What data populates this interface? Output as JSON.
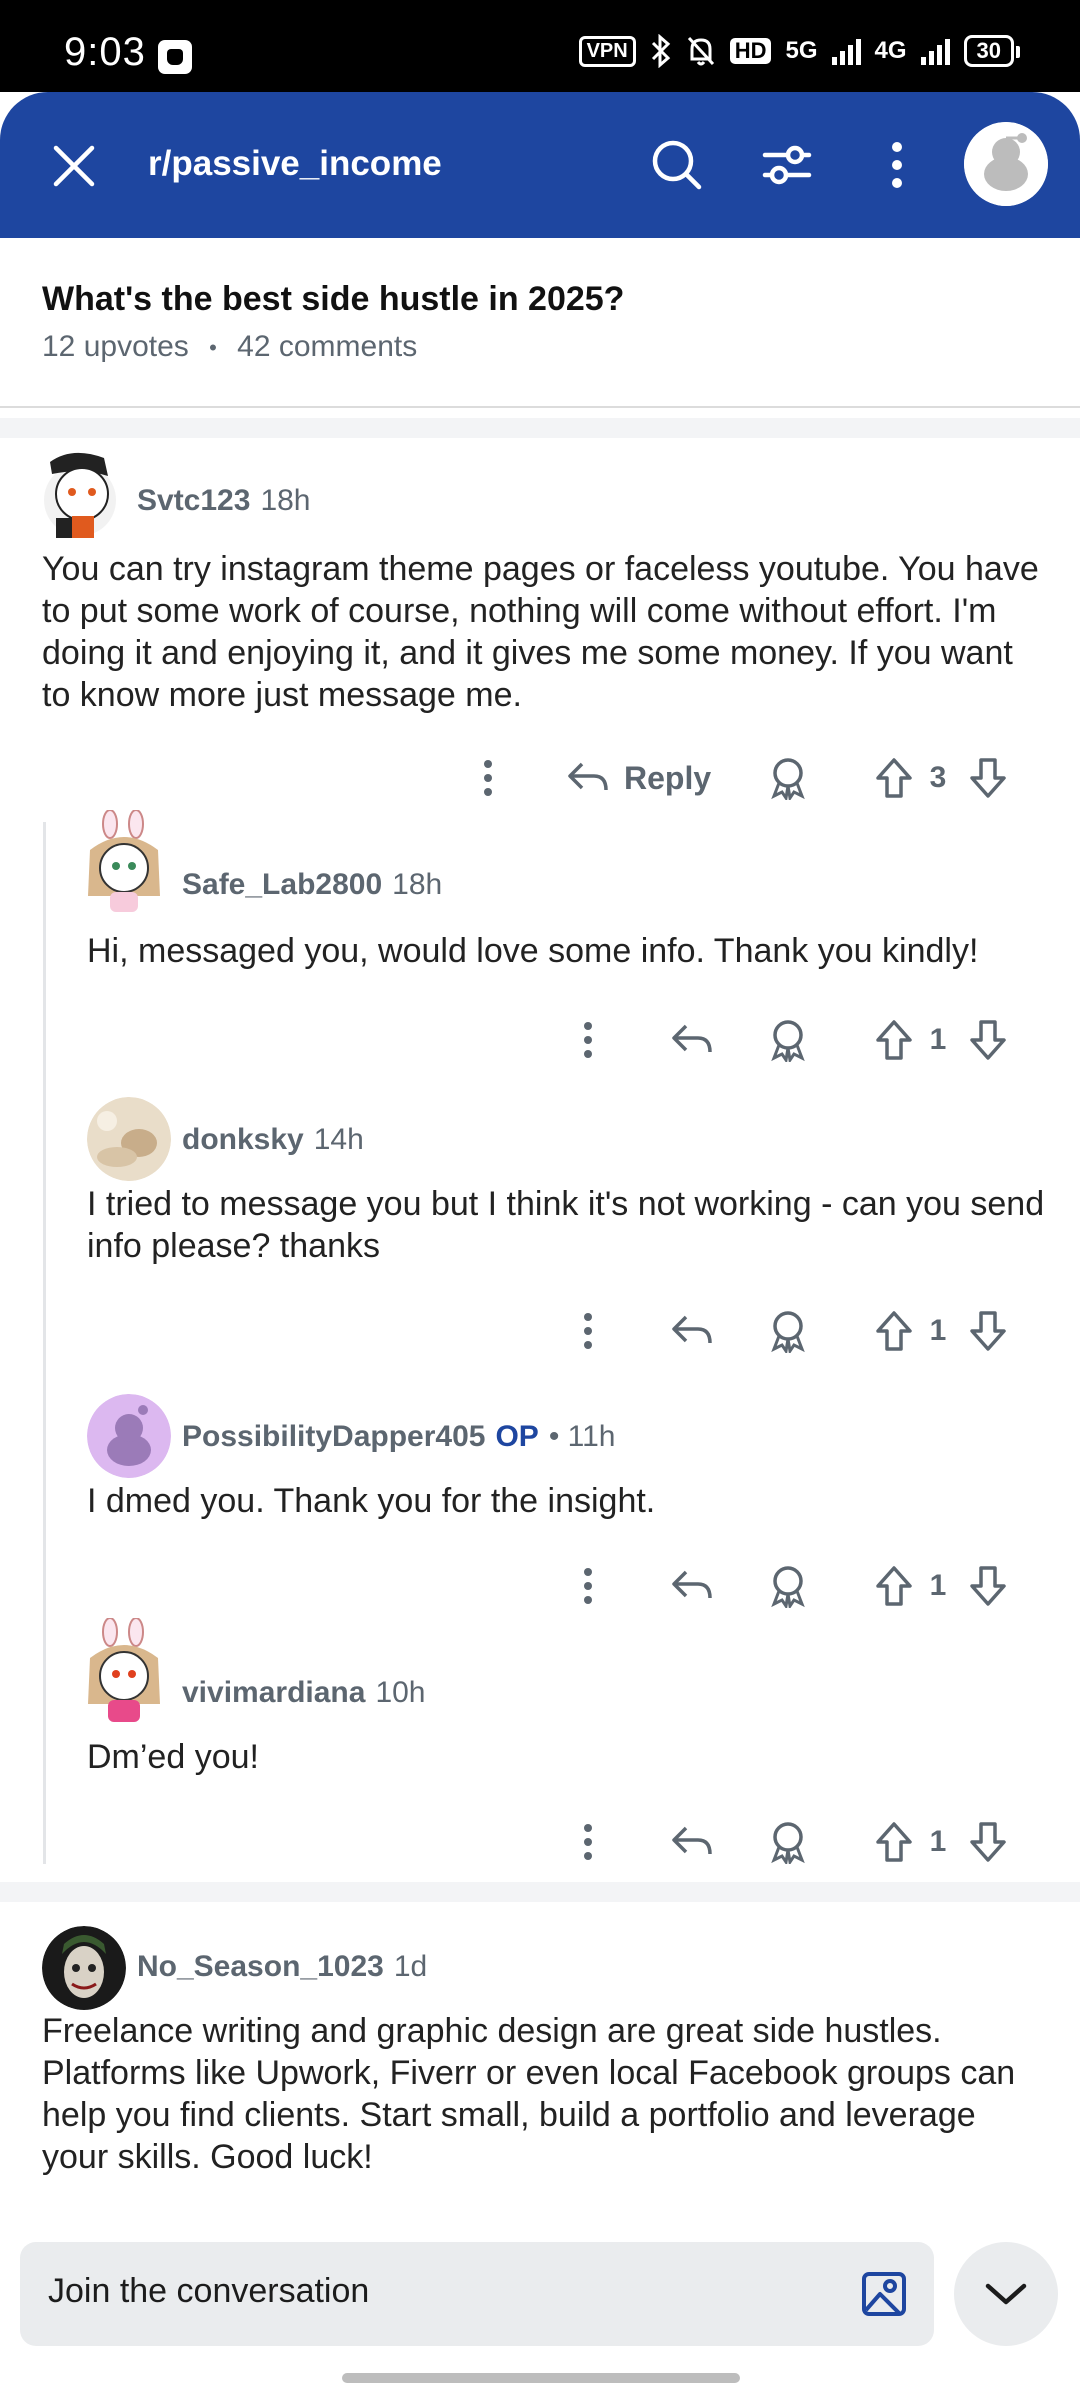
{
  "status_bar": {
    "time": "9:03",
    "vpn": "VPN",
    "hd": "HD",
    "net1": "5G",
    "net2": "4G",
    "battery": "30"
  },
  "header": {
    "subreddit": "r/passive_income"
  },
  "post": {
    "title": "What's the best side hustle in 2025?",
    "upvotes": "12 upvotes",
    "dot": "•",
    "comments": "42 comments"
  },
  "comments": [
    {
      "author": "Svtc123",
      "time": "18h",
      "body": "You can try instagram theme pages or faceless youtube. You have to put some work of course, nothing will come without effort. I'm doing it and enjoying it, and it gives me some money. If you want to know more just message me.",
      "reply_label": "Reply",
      "votes": "3"
    },
    {
      "author": "Safe_Lab2800",
      "time": "18h",
      "body": "Hi, messaged you, would love some info. Thank you kindly!",
      "votes": "1"
    },
    {
      "author": "donksky",
      "time": "14h",
      "body": "I tried to message you but I think it's not working - can you send info please? thanks",
      "votes": "1"
    },
    {
      "author": "PossibilityDapper405",
      "op": "OP",
      "time": "• 11h",
      "body": "I dmed you. Thank you for the insight.",
      "votes": "1"
    },
    {
      "author": "vivimardiana",
      "time": "10h",
      "body": "Dm’ed you!",
      "votes": "1"
    },
    {
      "author": "No_Season_1023",
      "time": "1d",
      "body": "Freelance writing and graphic design are great side hustles. Platforms like Upwork, Fiverr or even local Facebook groups can help you find clients. Start small, build a portfolio and leverage your skills. Good luck!"
    }
  ],
  "composer": {
    "placeholder": "Join the conversation"
  },
  "colors": {
    "header_bg": "#1e46a0",
    "muted_text": "#5c6670",
    "op_badge": "#1e46a0"
  },
  "icons": [
    "close-icon",
    "search-icon",
    "filter-icon",
    "more-vertical-icon",
    "avatar",
    "reply-icon",
    "award-icon",
    "upvote-icon",
    "downvote-icon",
    "image-icon",
    "chevron-down-icon"
  ]
}
